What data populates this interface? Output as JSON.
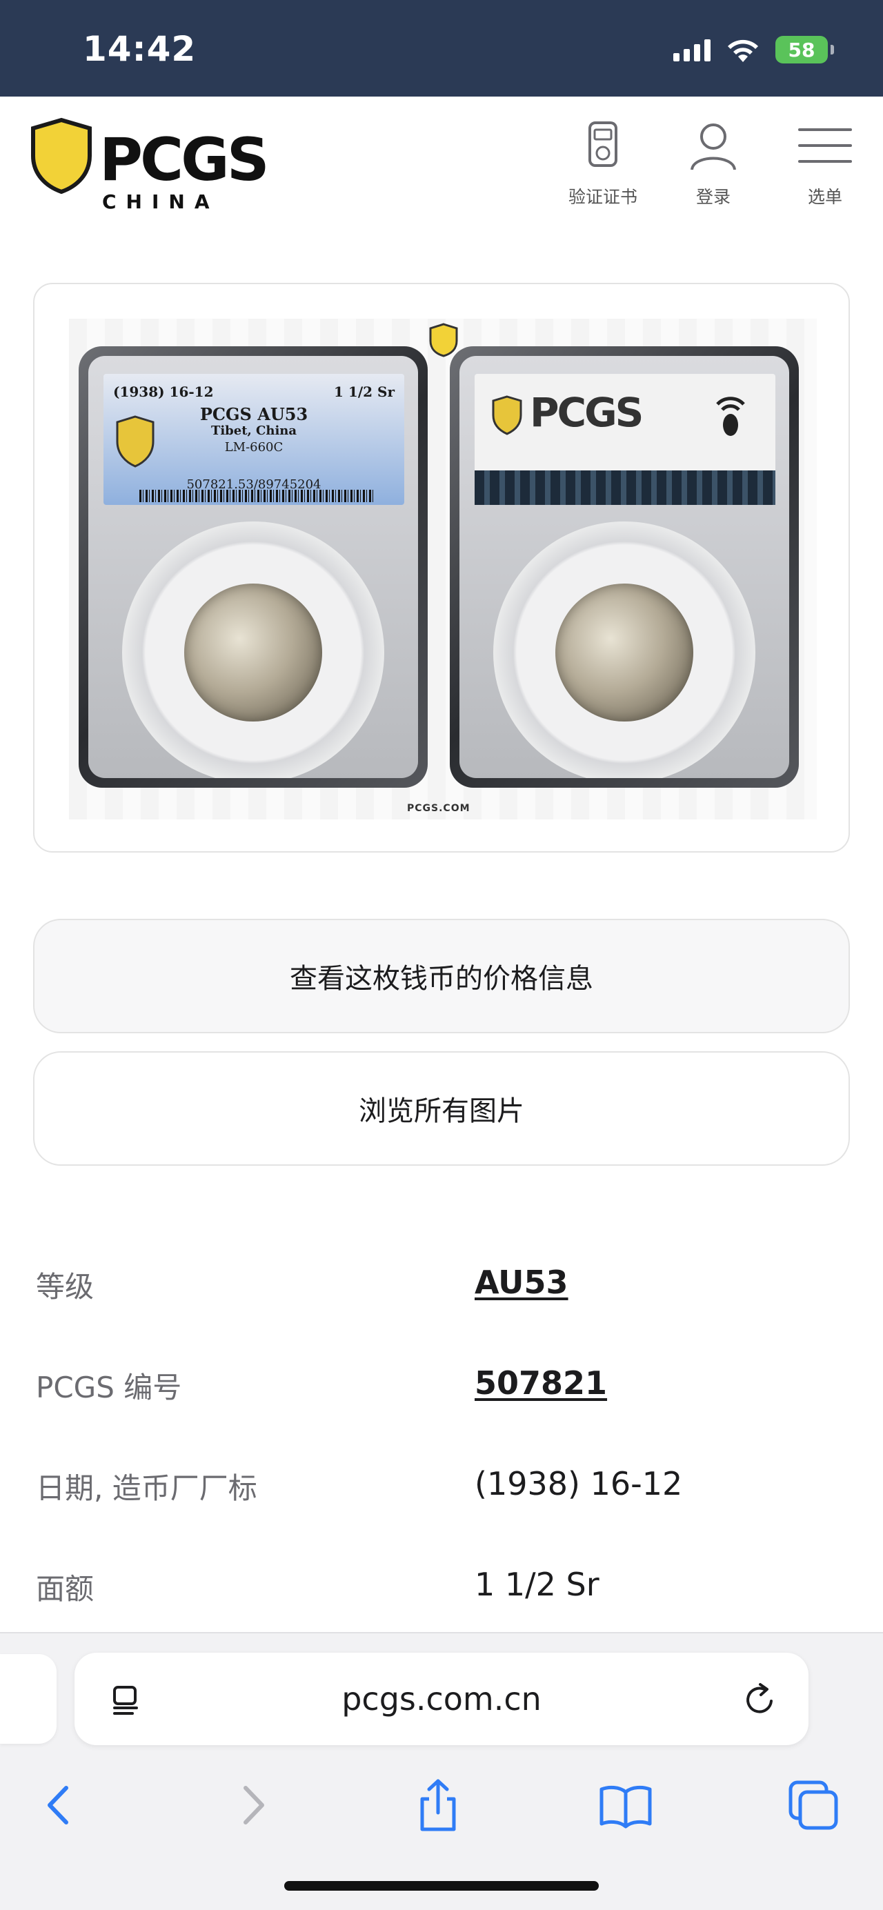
{
  "status_bar": {
    "time": "14:42",
    "battery": "58"
  },
  "header": {
    "logo_text": "PCGS",
    "logo_subtext": "CHINA",
    "verify_label": "验证证书",
    "login_label": "登录",
    "menu_label": "选单"
  },
  "coin_image": {
    "front_label": {
      "date": "(1938) 16-12",
      "denomination": "1 1/2 Sr",
      "grade": "PCGS AU53",
      "country": "Tibet, China",
      "variety": "LM-660C",
      "cert": "507821.53/89745204"
    },
    "back_label": {
      "brand": "PCGS"
    },
    "watermark": "PCGS.COM"
  },
  "buttons": {
    "price_info": "查看这枚钱币的价格信息",
    "all_photos": "浏览所有图片"
  },
  "details": [
    {
      "label": "等级",
      "value": "AU53",
      "link": true
    },
    {
      "label": "PCGS 编号",
      "value": "507821",
      "link": true
    },
    {
      "label": "日期, 造币厂厂标",
      "value": "(1938) 16-12",
      "link": false
    },
    {
      "label": "面额",
      "value": "1 1/2 Sr",
      "link": false
    }
  ],
  "browser": {
    "url": "pcgs.com.cn"
  },
  "colors": {
    "status_bar_bg": "#2b3a55",
    "logo_gold": "#f2d237",
    "battery": "#5ac35a",
    "toolbar_blue": "#2f7cf6"
  }
}
